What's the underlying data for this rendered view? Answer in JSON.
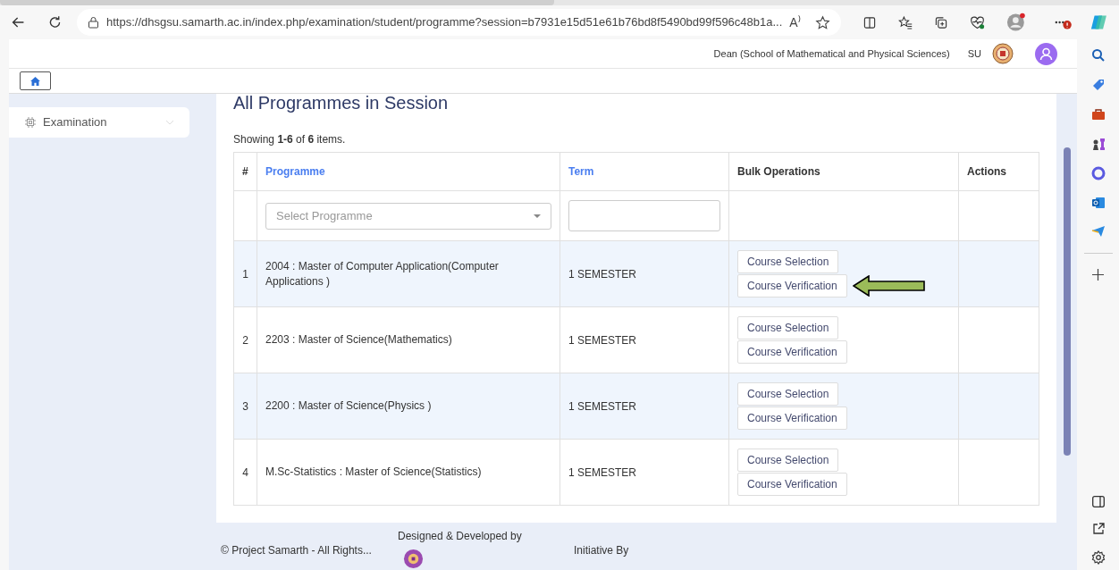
{
  "browser": {
    "url": "https://dhsgsu.samarth.ac.in/index.php/examination/student/programme?session=b7931e15d51e61b76bd8f5490bd99f596c48b1a...",
    "read_aloud": "A⁾"
  },
  "header": {
    "role": "Dean (School of Mathematical and Physical Sciences)",
    "initials": "SU"
  },
  "sidebar": {
    "items": [
      {
        "label": "Examination",
        "expanded": false
      }
    ]
  },
  "page": {
    "title": "All Programmes in Session",
    "summary": "Showing **1-6** of **6** items."
  },
  "table": {
    "columns": [
      {
        "label": "#",
        "sortable": false
      },
      {
        "label": "Programme",
        "sortable": true
      },
      {
        "label": "Term",
        "sortable": true
      },
      {
        "label": "Bulk Operations",
        "sortable": false
      },
      {
        "label": "Actions",
        "sortable": false
      }
    ],
    "filter_placeholder": "Select Programme",
    "rows": [
      {
        "num": "1",
        "programme": "2004 : Master of Computer Application(Computer Applications )",
        "term": "1 SEMESTER",
        "buttons": [
          "Course Selection",
          "Course Verification"
        ],
        "arrow": true
      },
      {
        "num": "2",
        "programme": "2203 : Master of Science(Mathematics)",
        "term": "1 SEMESTER",
        "buttons": [
          "Course Selection",
          "Course Verification"
        ],
        "arrow": false
      },
      {
        "num": "3",
        "programme": "2200 : Master of Science(Physics )",
        "term": "1 SEMESTER",
        "buttons": [
          "Course Selection",
          "Course Verification"
        ],
        "arrow": false
      },
      {
        "num": "4",
        "programme": "M.Sc-Statistics : Master of Science(Statistics)",
        "term": "1 SEMESTER",
        "buttons": [
          "Course Selection",
          "Course Verification"
        ],
        "arrow": false
      }
    ]
  },
  "footer": {
    "copyright": "© Project Samarth - All Rights...",
    "designed": "Designed & Developed by",
    "initiative": "Initiative By"
  }
}
